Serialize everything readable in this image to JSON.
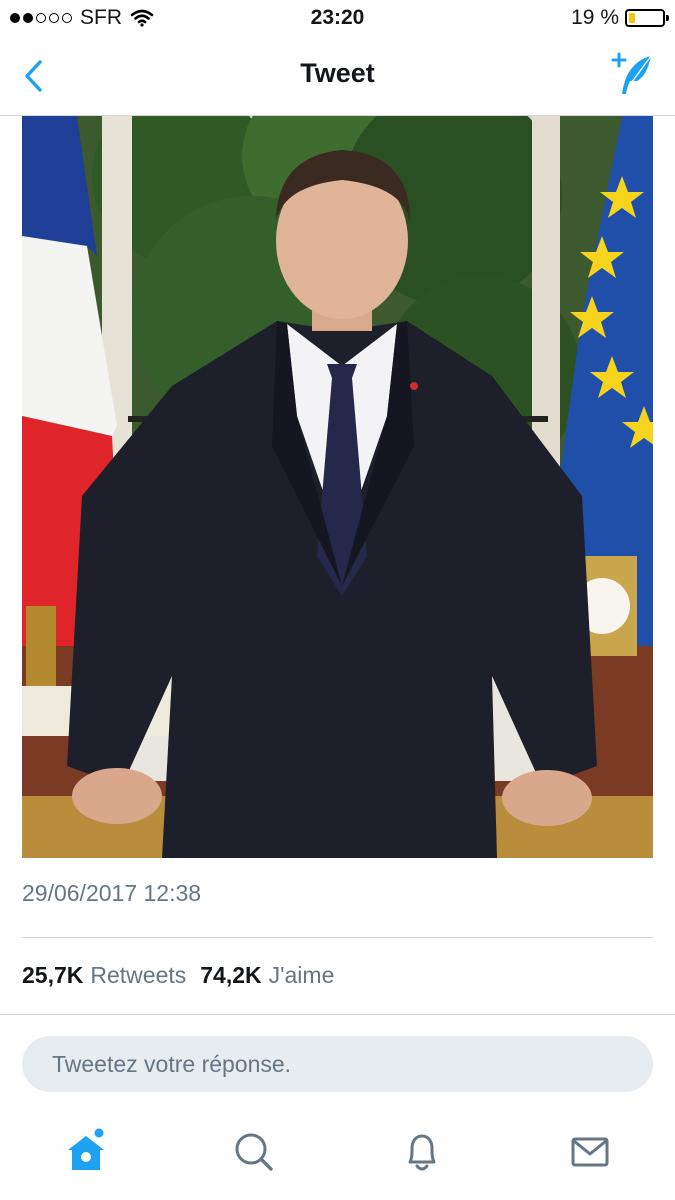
{
  "status_bar": {
    "carrier": "SFR",
    "signal_bars": 2,
    "time": "23:20",
    "battery_percent": "19 %",
    "battery_level": 0.19,
    "battery_color": "#f5c518"
  },
  "nav": {
    "title": "Tweet",
    "back_icon": "chevron-left-icon",
    "compose_icon": "compose-feather-icon"
  },
  "tweet": {
    "photo_description_icon": "photo-image",
    "timestamp": "29/06/2017 12:38",
    "retweets_count": "25,7K",
    "retweets_label": "Retweets",
    "likes_count": "74,2K",
    "likes_label": "J'aime"
  },
  "reply": {
    "placeholder": "Tweetez votre réponse."
  },
  "tab_bar": {
    "items": [
      {
        "name": "home",
        "icon": "home-icon",
        "active": true
      },
      {
        "name": "search",
        "icon": "search-icon",
        "active": false
      },
      {
        "name": "notifications",
        "icon": "bell-icon",
        "active": false
      },
      {
        "name": "messages",
        "icon": "envelope-icon",
        "active": false
      }
    ]
  },
  "colors": {
    "accent": "#1da1f2",
    "inactive_icon": "#657786",
    "divider": "#d5d9dd",
    "reply_bg": "#e6ecf0"
  }
}
